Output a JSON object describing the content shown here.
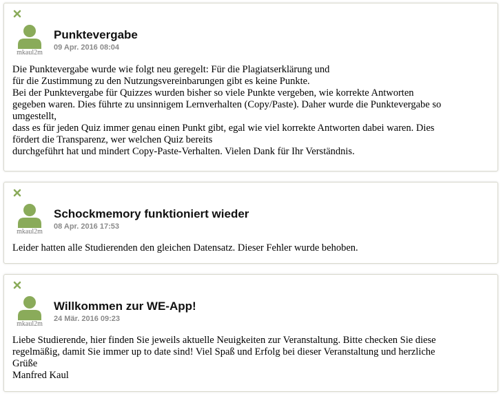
{
  "colors": {
    "close_icon": "#8aab5a",
    "avatar": "#8aab5a",
    "card_border": "#d8d8cc",
    "date_text": "#8a8a8a"
  },
  "posts": [
    {
      "author": "mkaul2m",
      "title": "Punktevergabe",
      "date": "09 Apr. 2016 08:04",
      "lines": [
        "Die Punktevergabe wurde wie folgt neu geregelt: Für die Plagiatserklärung und",
        "für die Zustimmung zu den Nutzungsvereinbarungen gibt es keine Punkte.",
        "Bei der Punktevergabe für Quizzes wurden bisher so viele Punkte vergeben, wie korrekte Antworten",
        "gegeben waren. Dies führte zu unsinnigem Lernverhalten (Copy/Paste). Daher wurde die Punktevergabe so",
        "umgestellt,",
        "dass es für jeden Quiz immer genau einen Punkt gibt, egal wie viel korrekte Antworten dabei waren. Dies",
        "fördert die Transparenz, wer welchen Quiz bereits",
        "durchgeführt hat und mindert Copy-Paste-Verhalten. Vielen Dank für Ihr Verständnis."
      ]
    },
    {
      "author": "mkaul2m",
      "title": "Schockmemory funktioniert wieder",
      "date": "08 Apr. 2016 17:53",
      "lines": [
        "Leider hatten alle Studierenden den gleichen Datensatz. Dieser Fehler wurde behoben."
      ]
    },
    {
      "author": "mkaul2m",
      "title": "Willkommen zur WE-App!",
      "date": "24 Mär. 2016 09:23",
      "lines": [
        "Liebe Studierende, hier finden Sie jeweils aktuelle Neuigkeiten zur Veranstaltung. Bitte checken Sie diese",
        "regelmäßig, damit Sie immer up to date sind! Viel Spaß und Erfolg bei dieser Veranstaltung und herzliche",
        "Grüße",
        "Manfred Kaul"
      ]
    }
  ]
}
